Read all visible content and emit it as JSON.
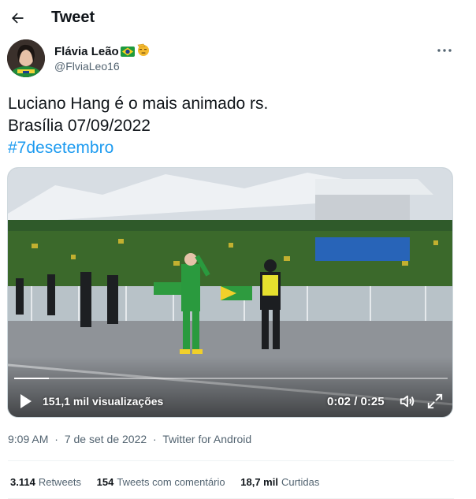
{
  "header": {
    "title": "Tweet",
    "back_icon": "arrow-left-icon"
  },
  "author": {
    "name": "Flávia Leão",
    "handle": "@FlviaLeo16",
    "emojis": [
      "brazil-flag-emoji",
      "saluting-face-emoji"
    ]
  },
  "tweet": {
    "lines": [
      "Luciano Hang é o mais animado rs.",
      "Brasília 07/09/2022"
    ],
    "hashtag": "#7desetembro"
  },
  "video": {
    "views": "151,1 mil visualizações",
    "time": "0:02 / 0:25",
    "progress_fraction": 0.08
  },
  "meta": {
    "time": "9:09 AM",
    "date": "7 de set de 2022",
    "separator": "·",
    "client": "Twitter for Android"
  },
  "stats": [
    {
      "value": "3.114",
      "label": "Retweets"
    },
    {
      "value": "154",
      "label": "Tweets com comentário"
    },
    {
      "value": "18,7 mil",
      "label": "Curtidas"
    }
  ],
  "colors": {
    "accent": "#1d9bf0",
    "secondary_text": "#536471",
    "primary_text": "#0f1419"
  }
}
